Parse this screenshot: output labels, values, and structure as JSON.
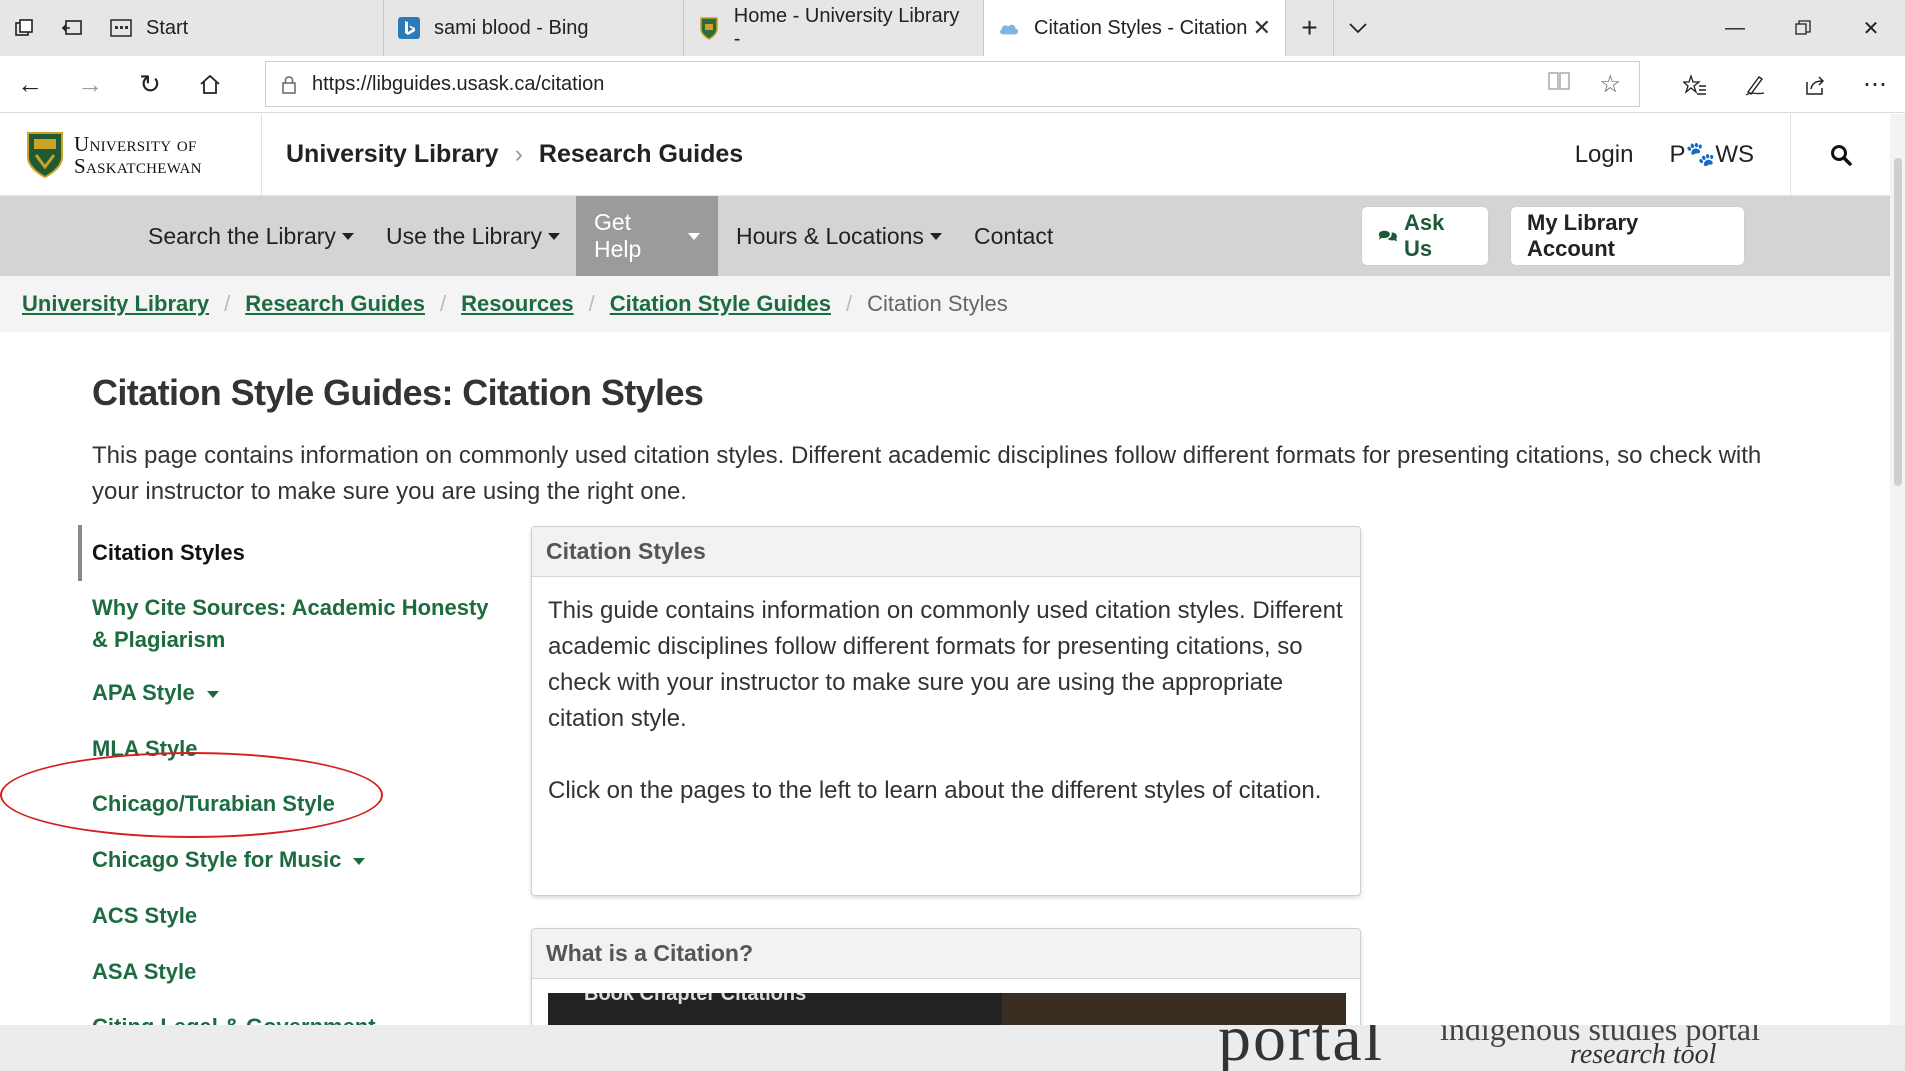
{
  "browser": {
    "tabs": [
      {
        "label": "Start",
        "icon": "start-icon"
      },
      {
        "label": "sami blood - Bing",
        "icon": "bing-icon"
      },
      {
        "label": "Home - University Library -",
        "icon": "usask-shield-icon"
      },
      {
        "label": "Citation Styles - Citation",
        "icon": "cloud-icon"
      }
    ],
    "url": "https://libguides.usask.ca/citation"
  },
  "header": {
    "logo_line1": "University of",
    "logo_line2": "Saskatchewan",
    "crumb1": "University Library",
    "crumb2": "Research Guides",
    "login": "Login",
    "paws": "P🐾WS"
  },
  "mainnav": {
    "items": [
      "Search the Library",
      "Use the Library",
      "Get Help",
      "Hours & Locations",
      "Contact"
    ],
    "ask_us": "Ask Us",
    "account": "My Library Account"
  },
  "breadcrumb": {
    "items": [
      "University Library",
      "Research Guides",
      "Resources",
      "Citation Style Guides"
    ],
    "current": "Citation Styles"
  },
  "page": {
    "title": "Citation Style Guides: Citation Styles",
    "description": "This page contains information on commonly used citation styles. Different academic disciplines follow different formats for presenting citations, so check with your instructor to make sure you are using the right one."
  },
  "sidenav": {
    "items": [
      "Citation Styles",
      "Why Cite Sources: Academic Honesty & Plagiarism",
      "APA Style",
      "MLA Style",
      "Chicago/Turabian Style",
      "Chicago Style for Music",
      "ACS Style",
      "ASA Style",
      "Citing Legal & Government"
    ]
  },
  "boxes": {
    "box1_title": "Citation Styles",
    "box1_p1": "This guide contains information on commonly used citation styles. Different academic disciplines follow different formats for presenting citations, so check with your instructor to make sure you are using the appropriate citation style.",
    "box1_p2": "Click on the pages to the left to learn about the different styles of citation.",
    "box2_title": "What is a Citation?",
    "video_text": "Book Chapter Citations"
  },
  "overlay": {
    "portal_big": "portal",
    "portal_small": "indigenous studies portal",
    "portal_tag": "research tool"
  },
  "colors": {
    "brand_green": "#1d6b40",
    "nav_gray": "#d4d4d4",
    "nav_active": "#9b9b9b",
    "annotation_red": "#d41f1f"
  }
}
